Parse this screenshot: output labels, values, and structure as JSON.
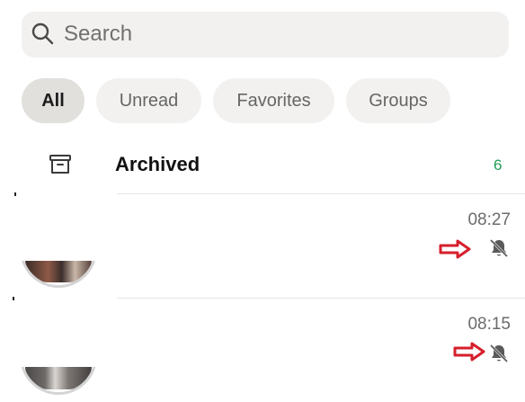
{
  "search": {
    "placeholder": "Search"
  },
  "filters": [
    {
      "label": "All",
      "active": true
    },
    {
      "label": "Unread",
      "active": false
    },
    {
      "label": "Favorites",
      "active": false
    },
    {
      "label": "Groups",
      "active": false
    }
  ],
  "archived": {
    "label": "Archived",
    "count": "6",
    "count_color": "#1f9d55",
    "icon": "archive-icon"
  },
  "chats": [
    {
      "time": "08:27",
      "muted": true,
      "icon": "muted-bell-icon"
    },
    {
      "time": "08:15",
      "muted": true,
      "icon": "muted-bell-icon"
    }
  ],
  "colors": {
    "chip_background": "#f2f1ef",
    "active_chip_background": "#e1e0dd",
    "accent": "#1f9d55",
    "annotation_arrow": "#d61f2c"
  }
}
